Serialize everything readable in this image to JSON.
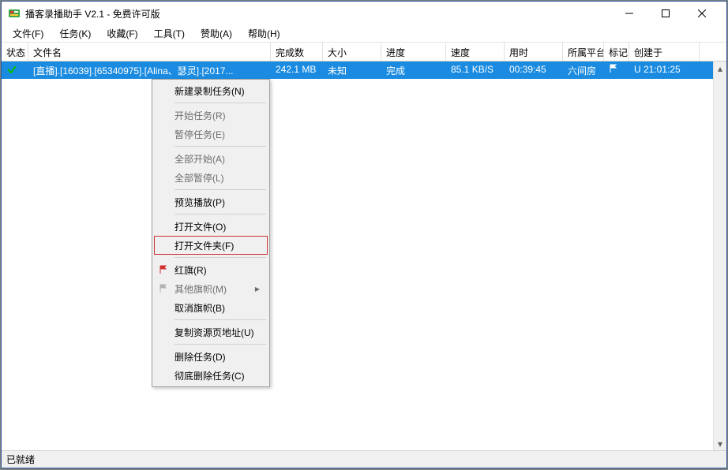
{
  "title": "播客录播助手 V2.1 - 免费许可版",
  "menus": [
    "文件(F)",
    "任务(K)",
    "收藏(F)",
    "工具(T)",
    "赞助(A)",
    "帮助(H)"
  ],
  "columns": [
    "状态",
    "文件名",
    "完成数",
    "大小",
    "进度",
    "速度",
    "用时",
    "所属平台",
    "标记",
    "创建于"
  ],
  "row": {
    "filename": "[直播].[16039].[65340975].[Alina、瑟灵].[2017...",
    "done": "242.1 MB",
    "size": "未知",
    "progress": "完成",
    "speed": "85.1 KB/S",
    "time": "00:39:45",
    "platform": "六间房",
    "created": "U 21:01:25"
  },
  "context_menu": [
    {
      "label": "新建录制任务(N)",
      "type": "item"
    },
    {
      "type": "sep"
    },
    {
      "label": "开始任务(R)",
      "type": "item",
      "disabled": true
    },
    {
      "label": "暂停任务(E)",
      "type": "item",
      "disabled": true
    },
    {
      "type": "sep"
    },
    {
      "label": "全部开始(A)",
      "type": "item",
      "disabled": true
    },
    {
      "label": "全部暂停(L)",
      "type": "item",
      "disabled": true
    },
    {
      "type": "sep"
    },
    {
      "label": "预览播放(P)",
      "type": "item"
    },
    {
      "type": "sep"
    },
    {
      "label": "打开文件(O)",
      "type": "item"
    },
    {
      "label": "打开文件夹(F)",
      "type": "item",
      "highlighted": true
    },
    {
      "type": "sep"
    },
    {
      "label": "红旗(R)",
      "type": "item",
      "icon": "red-flag"
    },
    {
      "label": "其他旗帜(M)",
      "type": "item",
      "icon": "grey-flag",
      "submenu": true,
      "disabled": true
    },
    {
      "label": "取消旗帜(B)",
      "type": "item"
    },
    {
      "type": "sep"
    },
    {
      "label": "复制资源页地址(U)",
      "type": "item"
    },
    {
      "type": "sep"
    },
    {
      "label": "删除任务(D)",
      "type": "item"
    },
    {
      "label": "彻底删除任务(C)",
      "type": "item"
    }
  ],
  "status": "已就绪"
}
